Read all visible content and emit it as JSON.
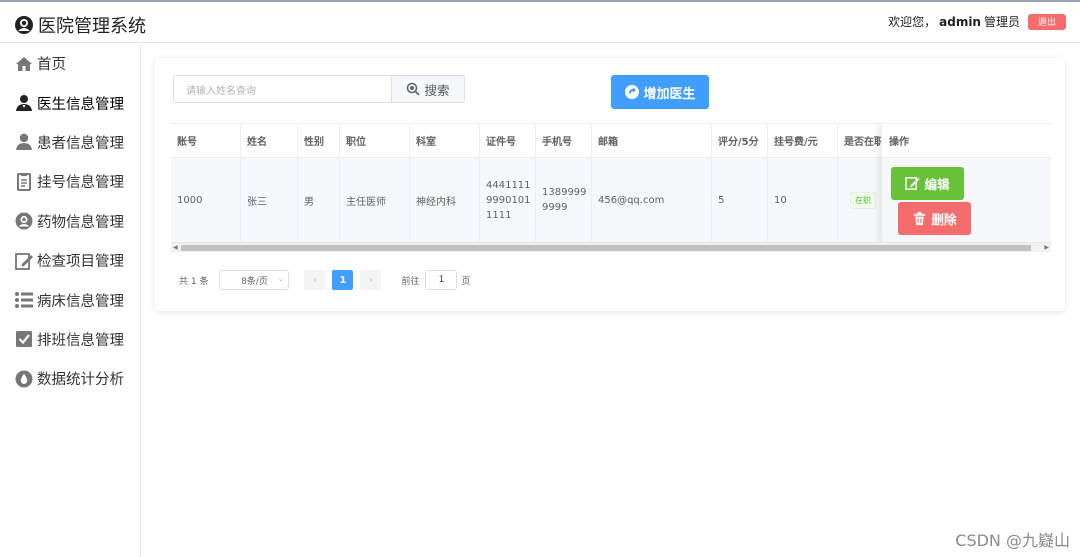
{
  "app": {
    "title": "医院管理系统"
  },
  "user": {
    "welcome": "欢迎您，",
    "name": "admin",
    "role": "管理员",
    "logout_label": "退出"
  },
  "sidebar": {
    "items": [
      {
        "label": "首页",
        "icon": "home-icon"
      },
      {
        "label": "医生信息管理",
        "icon": "doctor-icon",
        "active": true
      },
      {
        "label": "患者信息管理",
        "icon": "user-icon"
      },
      {
        "label": "挂号信息管理",
        "icon": "document-icon"
      },
      {
        "label": "药物信息管理",
        "icon": "medicine-icon"
      },
      {
        "label": "检查项目管理",
        "icon": "edit-icon"
      },
      {
        "label": "病床信息管理",
        "icon": "list-icon"
      },
      {
        "label": "排班信息管理",
        "icon": "checkbox-icon"
      },
      {
        "label": "数据统计分析",
        "icon": "drop-icon"
      }
    ]
  },
  "toolbar": {
    "search_placeholder": "请输入姓名查询",
    "search_label": "搜索",
    "add_label": "增加医生"
  },
  "table": {
    "columns": [
      "账号",
      "姓名",
      "性别",
      "职位",
      "科室",
      "证件号",
      "手机号",
      "邮箱",
      "评分/5分",
      "挂号费/元",
      "是否在职",
      "操作"
    ],
    "rows": [
      {
        "account": "1000",
        "name": "张三",
        "gender": "男",
        "title": "主任医师",
        "department": "神经内科",
        "id_number": "4441111\n9990101\n1111",
        "phone": "1389999\n9999",
        "email": "456@qq.com",
        "rating": "5",
        "fee": "10",
        "status": "在职",
        "edit_label": "编辑",
        "delete_label": "删除"
      }
    ]
  },
  "pagination": {
    "total_text": "共 1 条",
    "page_size_text": "8条/页",
    "current_page": "1",
    "goto_label": "前往",
    "goto_value": "1",
    "page_word": "页"
  },
  "watermark": "CSDN @九嶷山",
  "colors": {
    "primary": "#409eff",
    "success": "#67c23a",
    "danger": "#f56c6c"
  }
}
